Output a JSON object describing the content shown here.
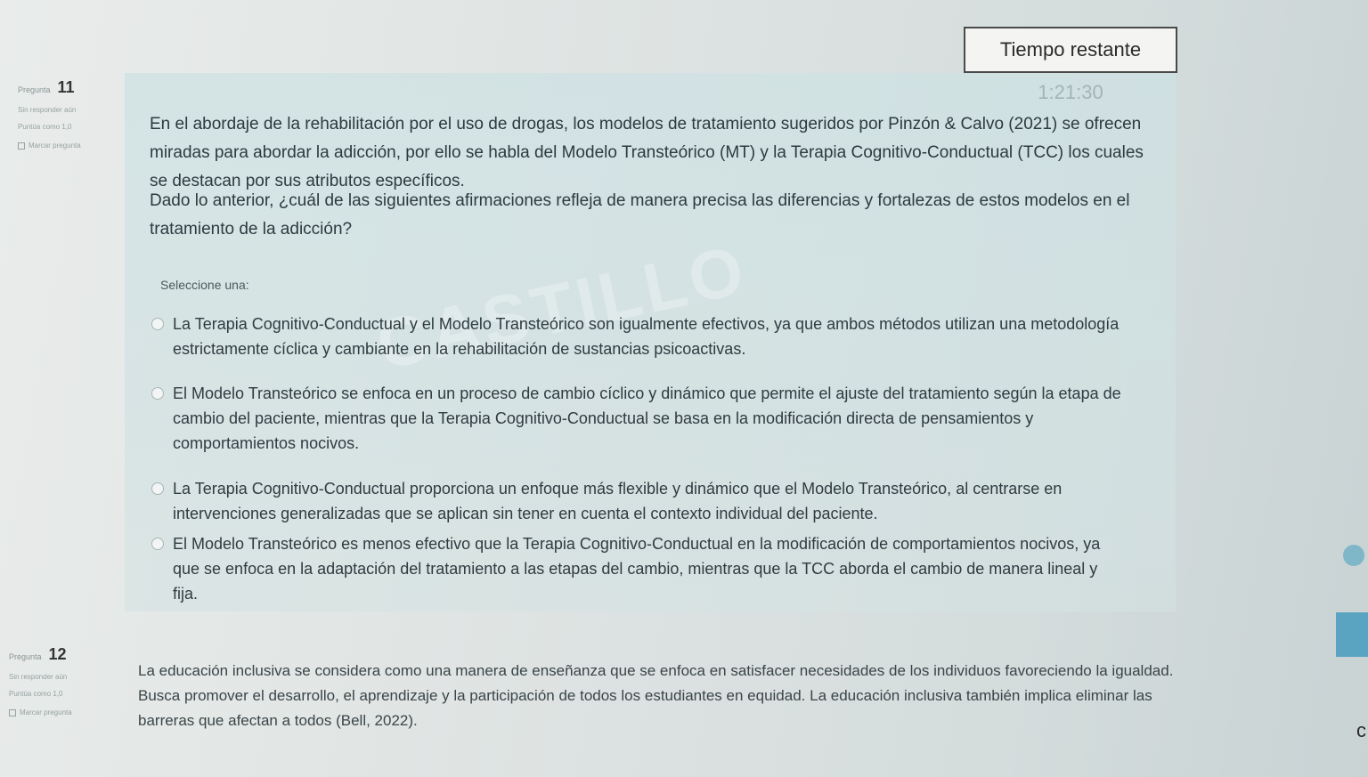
{
  "timer": {
    "text": "Tiempo restante 1:21:30"
  },
  "question11": {
    "label": "Pregunta",
    "number": "11",
    "status": "Sin responder aún",
    "score": "Puntúa como 1,0",
    "flag_label": "Marcar pregunta",
    "text_1": "En el abordaje de la rehabilitación por el uso de drogas, los modelos de tratamiento sugeridos por Pinzón & Calvo (2021) se ofrecen miradas para abordar la adicción, por ello se habla del Modelo Transteórico (MT) y la Terapia Cognitivo-Conductual (TCC) los cuales se destacan por sus atributos específicos.",
    "text_2": "Dado lo anterior, ¿cuál de las siguientes afirmaciones refleja de manera precisa las diferencias y fortalezas de estos modelos en el tratamiento de la adicción?",
    "prompt": "Seleccione una:",
    "options": [
      {
        "text": "La Terapia Cognitivo-Conductual y el Modelo Transteórico son igualmente efectivos, ya que ambos métodos utilizan una metodología estrictamente cíclica y cambiante en la rehabilitación de sustancias psicoactivas."
      },
      {
        "text": "El Modelo Transteórico se enfoca en un proceso de cambio cíclico y dinámico que permite el ajuste del tratamiento según la etapa de cambio del paciente, mientras que la Terapia Cognitivo-Conductual se basa en la modificación directa de pensamientos y comportamientos nocivos."
      },
      {
        "text": "La Terapia Cognitivo-Conductual proporciona un enfoque más flexible y dinámico que el Modelo Transteórico, al centrarse en intervenciones generalizadas que se aplican sin tener en cuenta el contexto individual del paciente."
      },
      {
        "text": "El Modelo Transteórico es menos efectivo que la Terapia Cognitivo-Conductual en la modificación de comportamientos nocivos, ya que se enfoca en la adaptación del tratamiento a las etapas del cambio, mientras que la TCC aborda el cambio de manera lineal y fija."
      }
    ]
  },
  "question12": {
    "label": "Pregunta",
    "number": "12",
    "status": "Sin responder aún",
    "score": "Puntúa como 1,0",
    "flag_label": "Marcar pregunta",
    "text": "La educación inclusiva se considera como una manera de enseñanza que se enfoca en satisfacer necesidades de los individuos favoreciendo la igualdad. Busca promover el desarrollo, el aprendizaje y la participación de todos los estudiantes en equidad. La educación inclusiva también implica eliminar las barreras que afectan a todos (Bell, 2022)."
  },
  "watermark": "CASTILLO"
}
